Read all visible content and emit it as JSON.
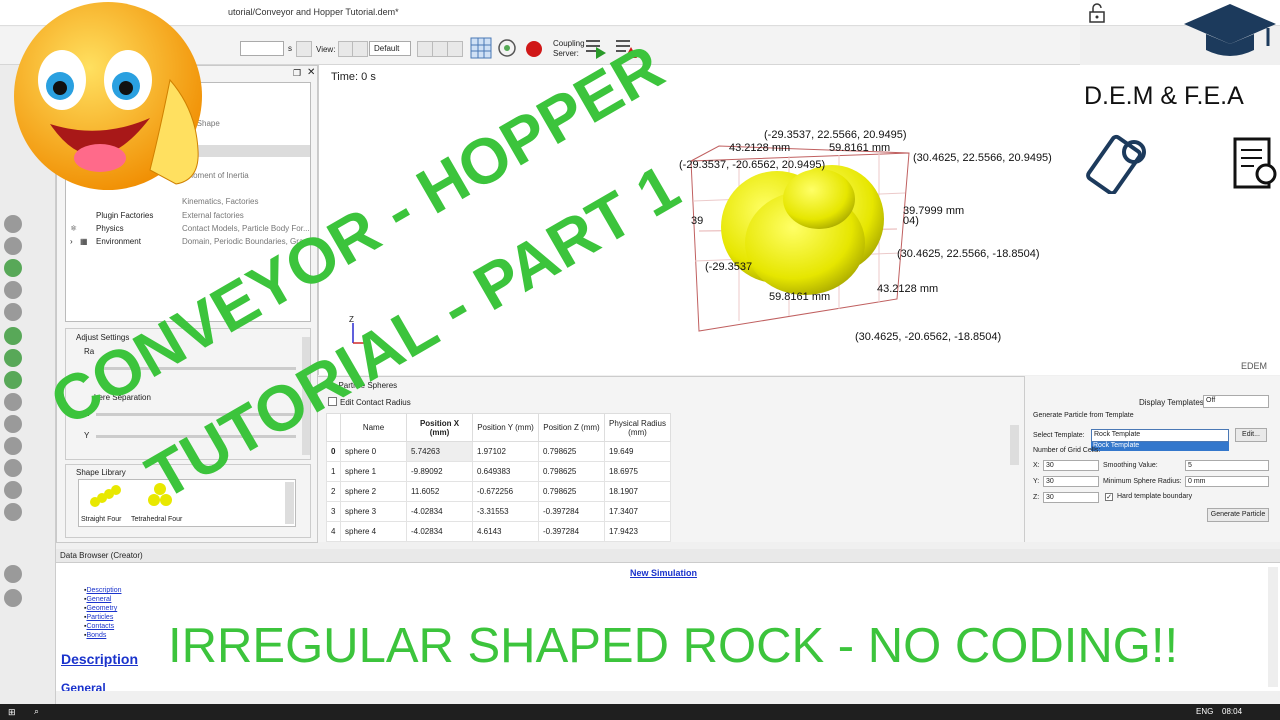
{
  "window": {
    "title": "utorial/Conveyor and Hopper Tutorial.dem*"
  },
  "toolbar": {
    "s_unit": "s",
    "view_label": "View:",
    "view_select": "Default",
    "coupling_label_1": "Coupling",
    "coupling_label_2": "Server:"
  },
  "tree": {
    "rows": [
      {
        "name": "",
        "desc": "ion"
      },
      {
        "name": "",
        "desc": "ize, Shape"
      },
      {
        "name": "",
        "desc": ", Moment of Inertia"
      },
      {
        "name": "",
        "desc": "Kinematics, Factories"
      },
      {
        "name": "Plugin Factories",
        "desc": "External factories"
      },
      {
        "name": "Physics",
        "desc": "Contact Models, Particle Body For..."
      },
      {
        "name": "Environment",
        "desc": "Domain, Periodic Boundaries, Gra..."
      }
    ]
  },
  "adjust": {
    "title": "Adjust Settings",
    "ra": "Ra",
    "sep": "here Separation",
    "x": "X",
    "y": "Y"
  },
  "shape_library": {
    "title": "Shape Library",
    "items": [
      "Straight Four",
      "Tetrahedral Four"
    ]
  },
  "viewport": {
    "time": "Time: 0 s",
    "coords": [
      "(-29.3537, 22.5566, 20.9495)",
      "43.2128 mm",
      "59.8161 mm",
      "(30.4625, 22.5566, 20.9495)",
      "(-29.3537, -20.6562, 20.9495)",
      "39.7999 mm",
      "04)",
      "39",
      "(30.4625, 22.5566, -18.8504)",
      "(-29.3537",
      "43.2128 mm",
      "59.8161 mm",
      "(30.4625, -20.6562, -18.8504)"
    ],
    "axis_z": "Z",
    "brand": "EDEM"
  },
  "spheres": {
    "panel_title": "Ra  Particle Spheres",
    "edit_contact": "Edit Contact Radius",
    "headers": [
      "",
      "Name",
      "Position X (mm)",
      "Position Y (mm)",
      "Position Z (mm)",
      "Physical Radius (mm)"
    ],
    "rows": [
      [
        "0",
        "sphere 0",
        "5.74263",
        "1.97102",
        "0.798625",
        "19.649"
      ],
      [
        "1",
        "sphere 1",
        "-9.89092",
        "0.649383",
        "0.798625",
        "18.6975"
      ],
      [
        "2",
        "sphere 2",
        "11.6052",
        "-0.672256",
        "0.798625",
        "18.1907"
      ],
      [
        "3",
        "sphere 3",
        "-4.02834",
        "-3.31553",
        "-0.397284",
        "17.3407"
      ],
      [
        "4",
        "sphere 4",
        "-4.02834",
        "4.6143",
        "-0.397284",
        "17.9423"
      ]
    ]
  },
  "generate": {
    "display_templates_label": "Display Templates:",
    "display_templates_value": "Off",
    "section_title": "Generate Particle from Template",
    "select_template_label": "Select Template:",
    "select_template_value": "Rock Template",
    "dropdown_option": "Rock Template",
    "edit_button": "Edit...",
    "grid_cells_label": "Number of Grid Cells:",
    "x_label": "X:",
    "x_value": "30",
    "y_label": "Y:",
    "y_value": "30",
    "z_label": "Z:",
    "z_value": "30",
    "smoothing_label": "Smoothing Value:",
    "smoothing_value": "5",
    "min_radius_label": "Minimum Sphere Radius:",
    "min_radius_value": "0 mm",
    "hard_boundary_label": "Hard template boundary",
    "generate_button": "Generate Particle"
  },
  "databrowser": {
    "header": "Data Browser (Creator)",
    "new_sim": "New Simulation",
    "links": [
      "Description",
      "General",
      "Geometry",
      "Particles",
      "Contacts",
      "Bonds"
    ],
    "h_description": "Description",
    "h_general": "General"
  },
  "overlays": {
    "title_line1": "CONVEYOR - HOPPER",
    "title_line2": "TUTORIAL - PART 1",
    "bottom_caption": "IRREGULAR SHAPED ROCK - NO CODING!!",
    "brand": "D.E.M & F.E.A"
  },
  "taskbar": {
    "lang": "ENG",
    "time": "08:04"
  },
  "colors": {
    "green": "#3cc43c",
    "yellow": "#e8e800",
    "link": "#1a33cc"
  }
}
